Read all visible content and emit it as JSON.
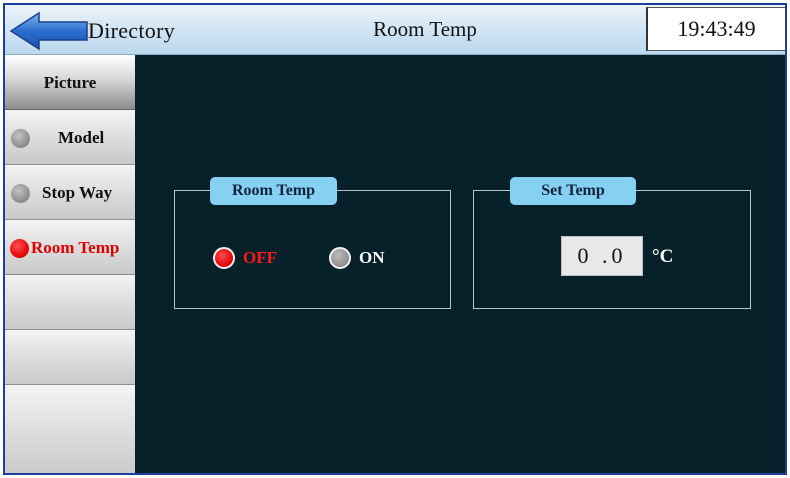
{
  "header": {
    "back_label": "Directory",
    "title": "Room Temp",
    "clock": "19:43:49"
  },
  "sidebar": {
    "items": [
      {
        "label": "Picture",
        "indicator": "none",
        "active": true
      },
      {
        "label": "Model",
        "indicator": "grey",
        "active": false
      },
      {
        "label": "Stop Way",
        "indicator": "grey",
        "active": false
      },
      {
        "label": "Room Temp",
        "indicator": "red",
        "active": false,
        "label_color": "#e00000"
      },
      {
        "label": ""
      },
      {
        "label": ""
      },
      {
        "label": ""
      }
    ]
  },
  "room_temp_panel": {
    "title": "Room Temp",
    "options": [
      {
        "label": "OFF",
        "selected": true,
        "color": "#ff1a1a"
      },
      {
        "label": "ON",
        "selected": false,
        "color": "#ffffff"
      }
    ]
  },
  "set_temp_panel": {
    "title": "Set Temp",
    "value": "0.0",
    "unit": "°C"
  },
  "colors": {
    "main_background": "#062129",
    "tab_background": "#86d0f4",
    "frame_border": "#1b3f9e",
    "active_red": "#e00000"
  }
}
